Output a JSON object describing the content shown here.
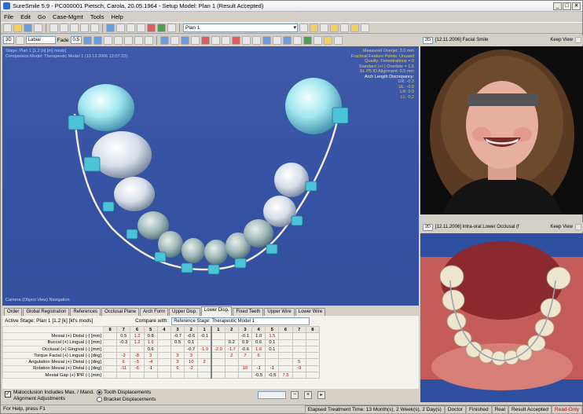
{
  "window": {
    "title": "SureSmile 5.9 - PC000001  Pietsch, Carola, 20.05.1964 - Setup Model: Plan 1 (Result Accepted)"
  },
  "menu": [
    "File",
    "Edit",
    "Go",
    "Case-Mgmt",
    "Tools",
    "Help"
  ],
  "toolbar": {
    "plan_value": "Plan 1"
  },
  "toolbar2": {
    "view_mode": "3D",
    "view_select": "Labial",
    "fade_label": "Fade",
    "fade_value": "0.5"
  },
  "viewer": {
    "stage_line1": "Stage: Plan 1 [1.2 [n] [m] mods]",
    "stage_line2": "Comparison Model: Therapeutic Model 1 (13.12.2006 12:07:22)",
    "info_lines": [
      "Measured Overjet: 3.0 mm",
      "Fractical Feature Points: Unused",
      "Quality: Fenestrations = 0",
      "Standard (+/-) Overbite = 1.5",
      "St. P5 ID Alignment: 0.5 mm",
      "Arch Length Discrepancy:"
    ],
    "info_values": [
      "UR: -0.3",
      "UL: -0.8",
      "LR: 0.0",
      "LL: 0.2"
    ],
    "footer": "Camera (Object View) Navigation"
  },
  "photo_top": {
    "mode": "2D",
    "label": "[12.11.2006] Facial Smile",
    "keep": "Keep View"
  },
  "photo_bottom": {
    "mode": "2D",
    "label": "[12.11.2006] Intra-oral Lower Occlusal (f",
    "keep": "Keep View"
  },
  "tabs": [
    "Order",
    "Global Registration",
    "References",
    "Occlusal Plane",
    "Arch Form",
    "Upper Disp.",
    "Lower Disp.",
    "Fixed Teeth",
    "Upper Wire",
    "Lower Wire"
  ],
  "active_tab": 6,
  "stage": {
    "label": "Active Stage: Plan 1 [1.2 [k] [kl's mods]",
    "compare_label": "Compare with:",
    "compare_value": "Reference Stage: Therapeutic Model 1"
  },
  "grid": {
    "headers": [
      "8",
      "7",
      "6",
      "5",
      "4",
      "3",
      "2",
      "1",
      "1",
      "2",
      "3",
      "4",
      "5",
      "6",
      "7",
      "8"
    ],
    "rows": [
      {
        "label": "Mesial (+) Distal (-) [mm]",
        "cells": [
          "",
          "0.5",
          "1.2",
          "0.8",
          "",
          "-0.7",
          "-0.6",
          "-0.1",
          "",
          "",
          "-0.1",
          "1.0",
          "1.5",
          "",
          "",
          ""
        ]
      },
      {
        "label": "Buccal (+) Lingual (-) [mm]",
        "cells": [
          "",
          "-0.3",
          "1.2",
          "1.6",
          "",
          "0.5",
          "0.1",
          "",
          "",
          "0.2",
          "0.9",
          "0.6",
          "0.1",
          "",
          "",
          ""
        ]
      },
      {
        "label": "Occlusal (+) Gingival (-) [mm]",
        "cells": [
          "",
          "",
          "",
          "0.6",
          "",
          "",
          "-0.7",
          "-1.9",
          "-2.0",
          "-1.7",
          "-0.6",
          "1.6",
          "0.1",
          "",
          "",
          ""
        ]
      },
      {
        "label": "Torque Facial (+) Lingual (-) [deg]",
        "cells": [
          "",
          "-2",
          "-8",
          "3",
          "",
          "3",
          "3",
          "",
          "",
          "2",
          "7",
          "6",
          "",
          "",
          "",
          ""
        ]
      },
      {
        "label": "Angulation Mesial (+) Distal (-) [deg]",
        "cells": [
          "",
          "6",
          "-5",
          "-4",
          "",
          "3",
          "10",
          "2",
          "",
          "",
          "",
          "",
          "",
          "",
          "5",
          ""
        ]
      },
      {
        "label": "Rotation Mesial (+) Distal (-) [deg]",
        "cells": [
          "",
          "-11",
          "-6",
          "-1",
          "",
          "6",
          "-2",
          "",
          "",
          "",
          "16",
          "-1",
          "-1",
          "",
          "-9",
          ""
        ]
      },
      {
        "label": "Mesial Gap (+) IPR (-) [mm]",
        "cells": [
          "",
          "",
          "",
          "",
          "",
          "",
          "",
          "",
          "",
          "",
          "",
          "-0.5",
          "-0.5",
          "7.5",
          "",
          ""
        ]
      }
    ]
  },
  "bottom": {
    "malocclusion": "Malocclusion Includes Max. / Mand. Alignment Adjustments",
    "radio1": "Tooth Displacements",
    "radio2": "Bracket Displacements"
  },
  "status": {
    "help": "For Help, press F1",
    "elapsed": "Elapsed Treatment Time: 13 Month(s), 2 Week(s), 2 Day(s)",
    "doctor": "Doctor",
    "finished": "Finished",
    "real": "Real",
    "result": "Result Accepted",
    "readonly": "Read-Only"
  }
}
